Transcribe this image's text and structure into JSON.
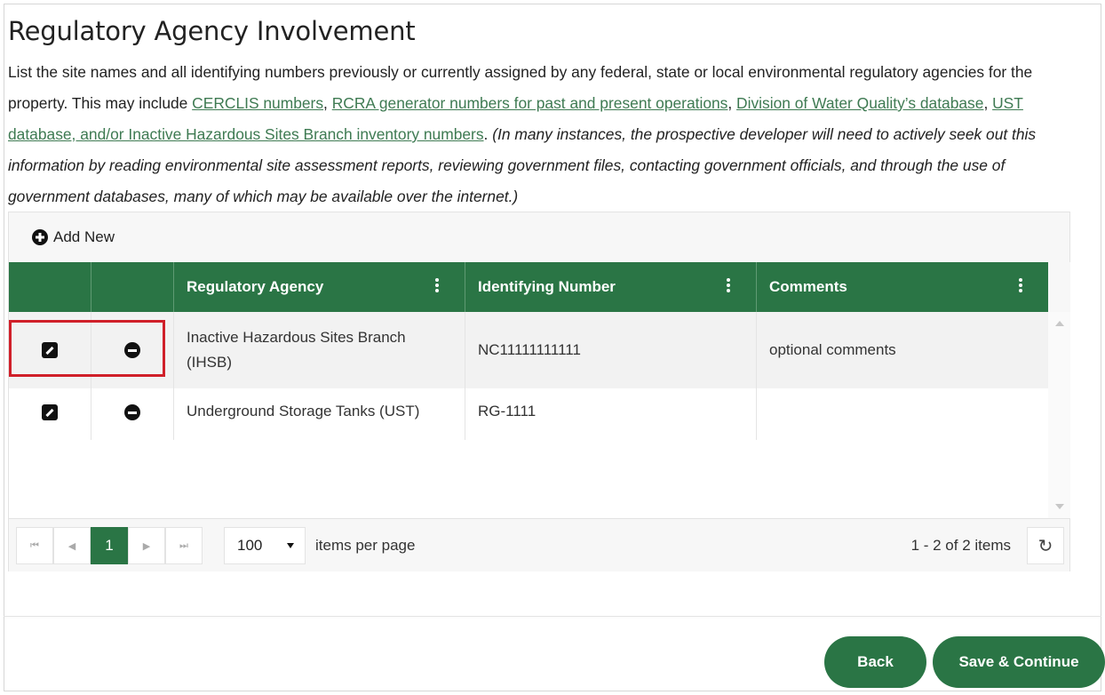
{
  "page": {
    "title": "Regulatory Agency Involvement",
    "description_intro": "List the site names and all identifying numbers previously or currently assigned by any federal, state or local environmental regulatory agencies for the property. This may include ",
    "links": [
      "CERCLIS numbers",
      "RCRA generator numbers for past and present operations",
      "Division of Water Quality’s database",
      "UST database, and/or Inactive Hazardous Sites Branch inventory numbers"
    ],
    "sep1": ", ",
    "sep2": ", ",
    "sep3": ", ",
    "period": ". ",
    "italic_note": "(In many instances, the prospective developer will need to actively seek out this information by reading environmental site assessment reports, reviewing government files, contacting government officials, and through the use of government databases, many of which may be available over the internet.)"
  },
  "grid": {
    "add_new_label": "Add New",
    "columns": [
      "Regulatory Agency",
      "Identifying Number",
      "Comments"
    ],
    "rows": [
      {
        "agency": "Inactive Hazardous Sites Branch (IHSB)",
        "number": "NC11111111111",
        "comments": "optional comments"
      },
      {
        "agency": "Underground Storage Tanks (UST)",
        "number": "RG-1111",
        "comments": ""
      }
    ],
    "pager": {
      "first": "⏮",
      "prev": "◀",
      "current_page": "1",
      "next": "▶",
      "last": "⏭",
      "page_size": "100",
      "items_per_page_label": "items per page",
      "summary": "1 - 2 of 2 items",
      "refresh": "↻"
    }
  },
  "footer": {
    "back_label": "Back",
    "save_label": "Save & Continue"
  },
  "colors": {
    "primary_green": "#2a7545",
    "link_green": "#3e7a52",
    "highlight_red": "#d0202a"
  }
}
